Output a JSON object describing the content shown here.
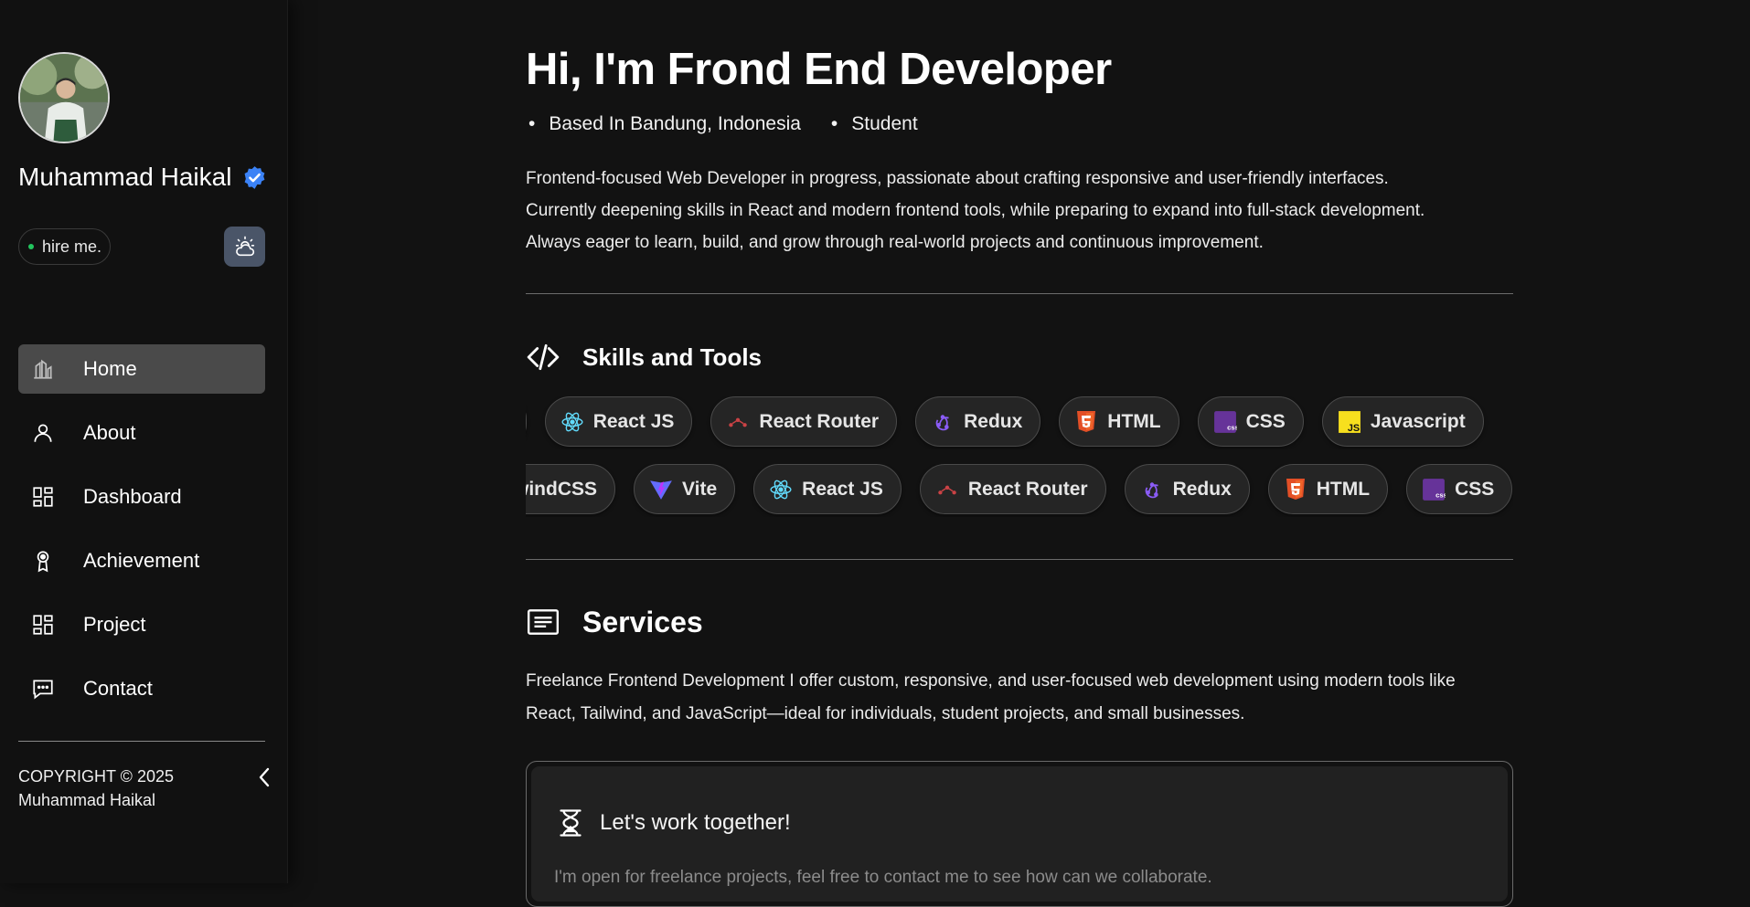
{
  "profile": {
    "name": "Muhammad Haikal",
    "hire_label": "hire me.",
    "status_color": "#22c55e"
  },
  "sidebar": {
    "nav_items": [
      {
        "label": "Home",
        "icon": "home-chart-icon",
        "active": true
      },
      {
        "label": "About",
        "icon": "user-icon",
        "active": false
      },
      {
        "label": "Dashboard",
        "icon": "dashboard-grid-icon",
        "active": false
      },
      {
        "label": "Achievement",
        "icon": "award-ribbon-icon",
        "active": false
      },
      {
        "label": "Project",
        "icon": "project-grid-icon",
        "active": false
      },
      {
        "label": "Contact",
        "icon": "chat-bubble-icon",
        "active": false
      }
    ],
    "copyright_line1": "COPYRIGHT © 2025",
    "copyright_line2": "Muhammad Haikal",
    "theme_toggle_icon": "cloud-sun-icon",
    "collapse_icon": "chevron-left-icon"
  },
  "hero": {
    "title": "Hi, I'm Frond End Developer",
    "location": "Based In Bandung, Indonesia",
    "role": "Student",
    "bio_lines": [
      "Frontend-focused Web Developer in progress, passionate about crafting responsive and user-friendly interfaces.",
      "Currently deepening skills in React and modern frontend tools, while preparing to expand into full-stack development.",
      "Always eager to learn, build, and grow through real-world projects and continuous improvement."
    ]
  },
  "skills": {
    "heading": "Skills and Tools",
    "row1": [
      {
        "label": "e",
        "icon": "partial-chip"
      },
      {
        "label": "React JS",
        "icon": "react-icon"
      },
      {
        "label": "React Router",
        "icon": "react-router-icon"
      },
      {
        "label": "Redux",
        "icon": "redux-icon"
      },
      {
        "label": "HTML",
        "icon": "html5-icon"
      },
      {
        "label": "CSS",
        "icon": "css3-icon"
      },
      {
        "label": "Javascript",
        "icon": "javascript-icon"
      }
    ],
    "row2": [
      {
        "label": "windCSS",
        "icon": "partial-chip"
      },
      {
        "label": "Vite",
        "icon": "vite-icon"
      },
      {
        "label": "React JS",
        "icon": "react-icon"
      },
      {
        "label": "React Router",
        "icon": "react-router-icon"
      },
      {
        "label": "Redux",
        "icon": "redux-icon"
      },
      {
        "label": "HTML",
        "icon": "html5-icon"
      },
      {
        "label": "CSS",
        "icon": "css3-icon"
      }
    ]
  },
  "services": {
    "heading": "Services",
    "text_line1": "Freelance Frontend Development I offer custom, responsive, and user-focused web development using modern tools like",
    "text_line2": "React, Tailwind, and JavaScript—ideal for individuals, student projects, and small businesses.",
    "cta_title": "Let's work together!",
    "cta_text": "I'm open for freelance projects, feel free to contact me to see how can we collaborate."
  }
}
